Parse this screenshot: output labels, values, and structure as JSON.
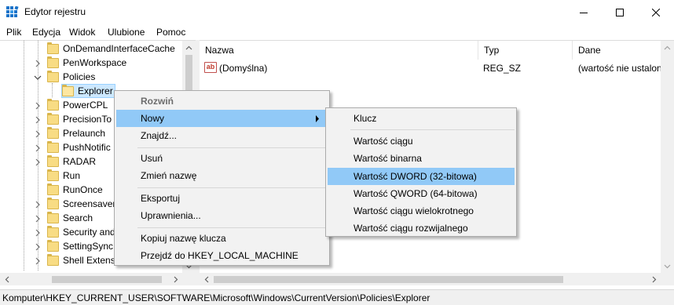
{
  "window": {
    "title": "Edytor rejestru",
    "icon": "registry-editor-icon",
    "controls": [
      "minimize-icon",
      "maximize-icon",
      "close-icon"
    ]
  },
  "menubar": {
    "items": [
      "Plik",
      "Edycja",
      "Widok",
      "Ulubione",
      "Pomoc"
    ]
  },
  "tree": {
    "items": [
      {
        "label": "OnDemandInterfaceCache",
        "expander": ""
      },
      {
        "label": "PenWorkspace",
        "expander": "collapsed"
      },
      {
        "label": "Policies",
        "expander": "expanded"
      },
      {
        "label": "Explorer",
        "expander": "",
        "selected": true
      },
      {
        "label": "PowerCPL",
        "expander": "collapsed"
      },
      {
        "label": "PrecisionTo",
        "expander": "collapsed"
      },
      {
        "label": "Prelaunch",
        "expander": "collapsed"
      },
      {
        "label": "PushNotific",
        "expander": "collapsed"
      },
      {
        "label": "RADAR",
        "expander": "collapsed"
      },
      {
        "label": "Run",
        "expander": ""
      },
      {
        "label": "RunOnce",
        "expander": ""
      },
      {
        "label": "Screensaver",
        "expander": "collapsed"
      },
      {
        "label": "Search",
        "expander": "collapsed"
      },
      {
        "label": "Security and",
        "expander": "collapsed"
      },
      {
        "label": "SettingSync",
        "expander": "collapsed"
      },
      {
        "label": "Shell Extens",
        "expander": "collapsed"
      }
    ]
  },
  "list": {
    "columns": [
      "Nazwa",
      "Typ",
      "Dane"
    ],
    "rows": [
      {
        "icon": "string-value-icon",
        "name": "(Domyślna)",
        "type": "REG_SZ",
        "data": "(wartość nie ustalona)"
      }
    ]
  },
  "context_menu": {
    "items": [
      {
        "label": "Rozwiń",
        "disabled": true
      },
      {
        "label": "Nowy",
        "submenu": true,
        "highlighted": true
      },
      {
        "label": "Znajdź..."
      },
      {
        "separator": true
      },
      {
        "label": "Usuń"
      },
      {
        "label": "Zmień nazwę"
      },
      {
        "separator": true
      },
      {
        "label": "Eksportuj"
      },
      {
        "label": "Uprawnienia..."
      },
      {
        "separator": true
      },
      {
        "label": "Kopiuj nazwę klucza"
      },
      {
        "label": "Przejdź do HKEY_LOCAL_MACHINE"
      }
    ]
  },
  "submenu": {
    "items": [
      {
        "label": "Klucz"
      },
      {
        "separator": true
      },
      {
        "label": "Wartość ciągu"
      },
      {
        "label": "Wartość binarna"
      },
      {
        "label": "Wartość DWORD (32-bitowa)",
        "highlighted": true
      },
      {
        "label": "Wartość QWORD (64-bitowa)"
      },
      {
        "label": "Wartość ciągu wielokrotnego"
      },
      {
        "label": "Wartość ciągu rozwijalnego"
      }
    ]
  },
  "statusbar": {
    "path": "Komputer\\HKEY_CURRENT_USER\\SOFTWARE\\Microsoft\\Windows\\CurrentVersion\\Policies\\Explorer"
  },
  "colors": {
    "highlight": "#91c9f7",
    "selection": "#cce8ff",
    "folder": "#f8dc84"
  }
}
